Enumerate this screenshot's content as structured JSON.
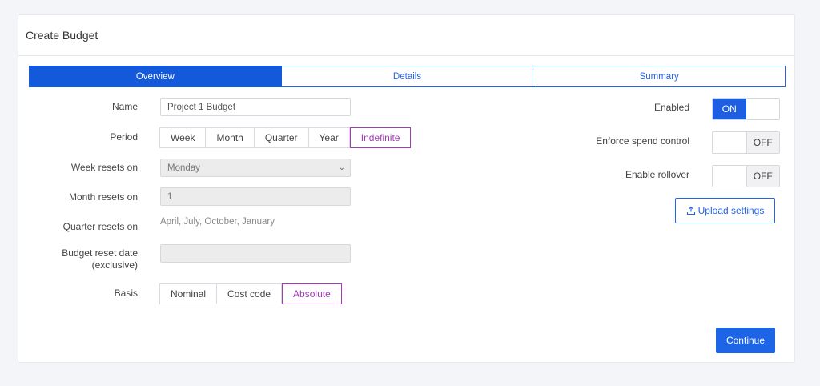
{
  "card": {
    "title": "Create Budget"
  },
  "tabs": [
    {
      "label": "Overview",
      "active": true
    },
    {
      "label": "Details",
      "active": false
    },
    {
      "label": "Summary",
      "active": false
    }
  ],
  "form": {
    "name": {
      "label": "Name",
      "value": "Project 1 Budget"
    },
    "period": {
      "label": "Period",
      "options": [
        "Week",
        "Month",
        "Quarter",
        "Year",
        "Indefinite"
      ],
      "selected": "Indefinite"
    },
    "week_resets": {
      "label": "Week resets on",
      "value": "Monday"
    },
    "month_resets": {
      "label": "Month resets on",
      "value": "1"
    },
    "quarter_resets": {
      "label": "Quarter resets on",
      "value": "April, July, October, January"
    },
    "budget_reset_date": {
      "label_line1": "Budget reset date",
      "label_line2": "(exclusive)",
      "value": ""
    },
    "basis": {
      "label": "Basis",
      "options": [
        "Nominal",
        "Cost code",
        "Absolute"
      ],
      "selected": "Absolute"
    }
  },
  "settings": {
    "enabled": {
      "label": "Enabled",
      "state": "ON"
    },
    "enforce_spend": {
      "label": "Enforce spend control",
      "state": "OFF"
    },
    "enable_rollover": {
      "label": "Enable rollover",
      "state": "OFF"
    }
  },
  "buttons": {
    "upload": "Upload settings",
    "continue": "Continue"
  },
  "colors": {
    "primary": "#1e64e6",
    "selected_segment": "#a13cb4",
    "background": "#f4f5f8"
  }
}
